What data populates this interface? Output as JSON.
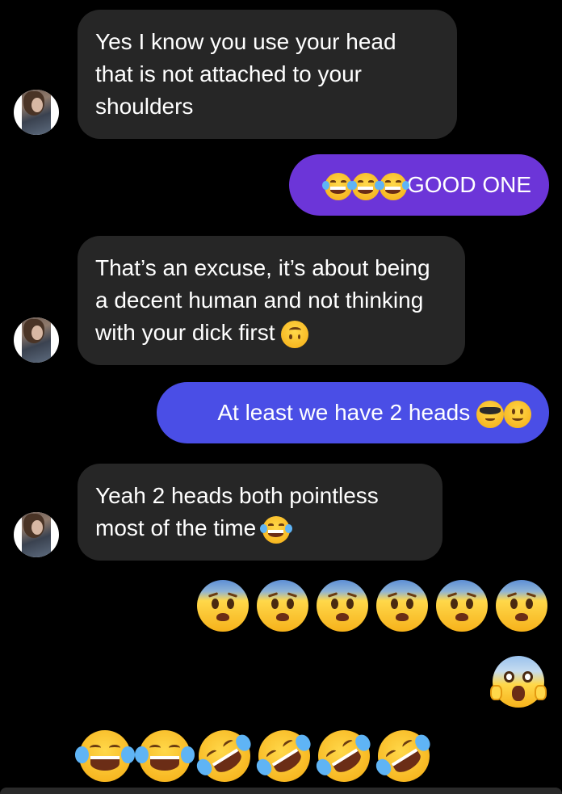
{
  "conversation": {
    "messages": [
      {
        "direction": "incoming",
        "text": "Yes I know you use your head that is not attached to your shoulders"
      },
      {
        "direction": "outgoing",
        "color": "#6c35d8",
        "text": "GOOD ONE",
        "emojis_before": [
          "face-with-tears-of-joy",
          "face-with-tears-of-joy",
          "face-with-tears-of-joy"
        ]
      },
      {
        "direction": "incoming",
        "text": "That’s an excuse, it’s about being a decent human and not thinking with your dick first",
        "emojis_after": [
          "upside-down-face"
        ]
      },
      {
        "direction": "outgoing",
        "color": "#4a4ee6",
        "text": "At least we have 2 heads",
        "emojis_after": [
          "smiling-face-with-sunglasses",
          "slightly-smiling-face"
        ]
      },
      {
        "direction": "incoming",
        "text": "Yeah 2 heads both pointless most of the time",
        "emojis_after": [
          "face-with-tears-of-joy"
        ]
      },
      {
        "direction": "outgoing",
        "type": "emoji-only",
        "emojis": [
          "anxious-face",
          "anxious-face",
          "anxious-face",
          "anxious-face",
          "anxious-face",
          "anxious-face"
        ]
      },
      {
        "direction": "outgoing",
        "type": "emoji-only",
        "emojis": [
          "face-screaming-in-fear"
        ]
      },
      {
        "direction": "incoming",
        "type": "emoji-only",
        "emojis": [
          "face-with-tears-of-joy",
          "face-with-tears-of-joy",
          "rolling-on-the-floor-laughing",
          "rolling-on-the-floor-laughing",
          "rolling-on-the-floor-laughing",
          "rolling-on-the-floor-laughing"
        ]
      }
    ]
  },
  "colors": {
    "background": "#000000",
    "incoming_bubble": "#262626",
    "outgoing_purple": "#6c35d8",
    "outgoing_blue": "#4a4ee6",
    "text": "#ffffff"
  }
}
